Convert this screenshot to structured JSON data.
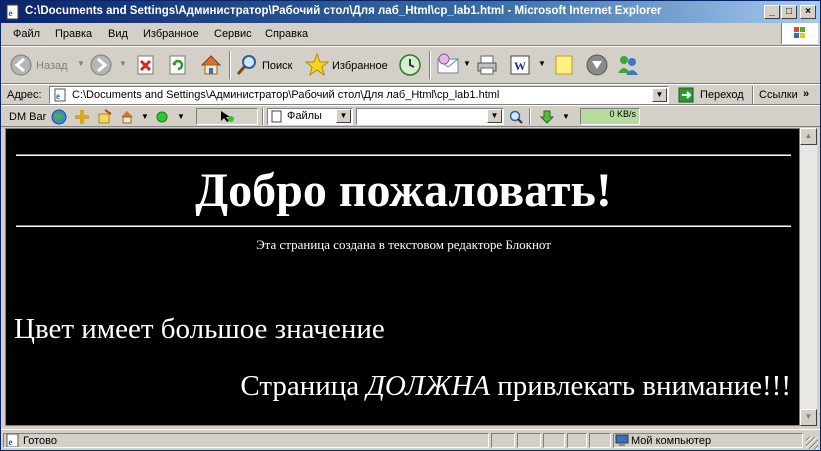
{
  "window": {
    "title": "C:\\Documents and Settings\\Администратор\\Рабочий стол\\Для лаб_Html\\cp_lab1.html - Microsoft Internet Explorer"
  },
  "menu": {
    "items": [
      "Файл",
      "Правка",
      "Вид",
      "Избранное",
      "Сервис",
      "Справка"
    ]
  },
  "toolbar": {
    "back_label": "Назад",
    "search_label": "Поиск",
    "favorites_label": "Избранное"
  },
  "address": {
    "label": "Адрес:",
    "value": "C:\\Documents and Settings\\Администратор\\Рабочий стол\\Для лаб_Html\\cp_lab1.html",
    "go_label": "Переход",
    "links_label": "Ссылки"
  },
  "dmbar": {
    "label": "DM Bar",
    "files_label": "Файлы",
    "speed_label": "0 KB/s"
  },
  "page": {
    "heading": "Добро пожаловать!",
    "subtitle": "Эта страница создана в текстовом редакторе Блокнот",
    "color_line": "Цвет имеет большое значение",
    "attention_before": "Страница ",
    "attention_em": "ДОЛЖНА",
    "attention_after": " привлекать внимание!!!"
  },
  "status": {
    "text": "Готово",
    "zone": "Мой компьютер"
  },
  "colors": {
    "title_start": "#0a246a",
    "title_end": "#a6caf0",
    "page_bg": "#000000",
    "page_text": "#ffffff"
  }
}
